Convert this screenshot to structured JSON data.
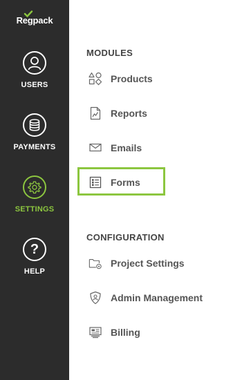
{
  "brand": {
    "logo_text": "Regpack",
    "accent": "#8cc63f",
    "sidebar_bg": "#2c2c2c"
  },
  "sidebar": {
    "items": [
      {
        "label": "USERS",
        "icon": "user-icon"
      },
      {
        "label": "PAYMENTS",
        "icon": "coins-icon"
      },
      {
        "label": "SETTINGS",
        "icon": "gear-icon",
        "active": true
      },
      {
        "label": "HELP",
        "icon": "question-icon"
      }
    ]
  },
  "main": {
    "modules": {
      "header": "MODULES",
      "items": [
        {
          "label": "Products",
          "icon": "shapes-icon"
        },
        {
          "label": "Reports",
          "icon": "report-chart-icon"
        },
        {
          "label": "Emails",
          "icon": "envelope-icon"
        },
        {
          "label": "Forms",
          "icon": "form-list-icon",
          "highlighted": true
        }
      ]
    },
    "configuration": {
      "header": "CONFIGURATION",
      "items": [
        {
          "label": "Project Settings",
          "icon": "folder-gear-icon"
        },
        {
          "label": "Admin Management",
          "icon": "shield-user-icon"
        },
        {
          "label": "Billing",
          "icon": "billing-card-icon"
        }
      ]
    }
  }
}
